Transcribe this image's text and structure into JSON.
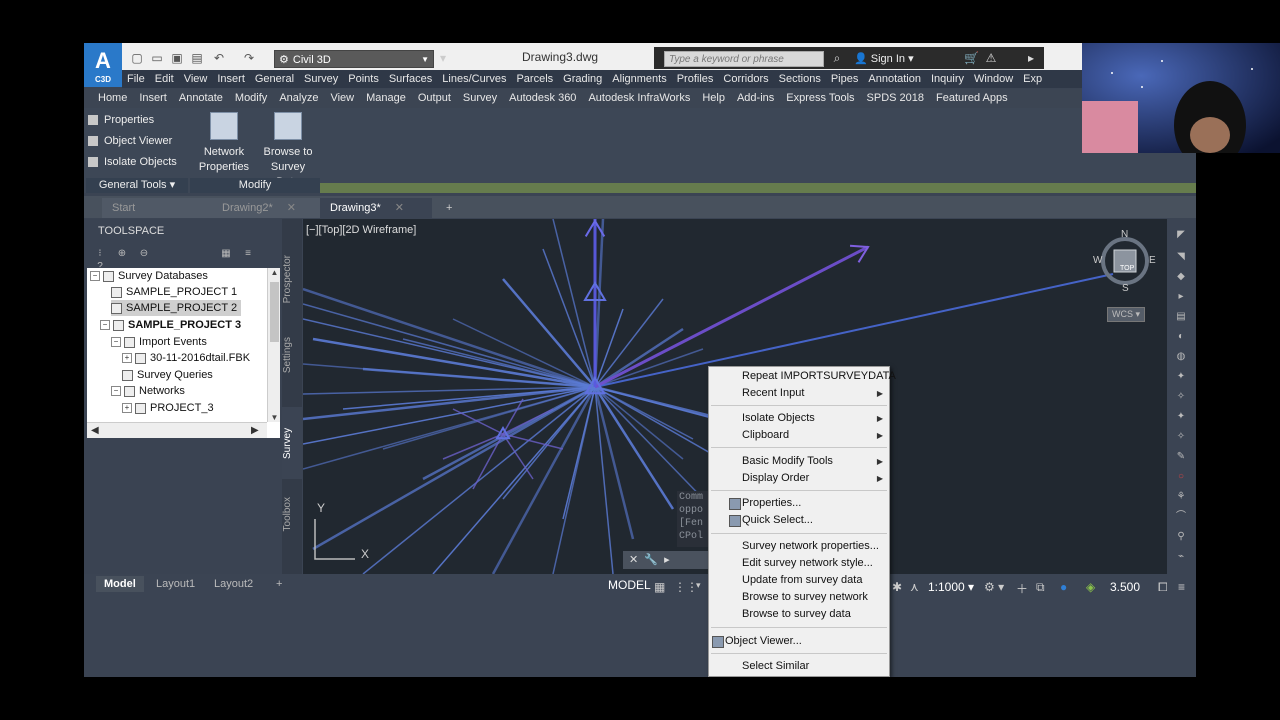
{
  "window": {
    "logo": "A",
    "logo_sub": "C3D",
    "workspace": "Civil 3D",
    "document_title": "Drawing3.dwg",
    "search_placeholder": "Type a keyword or phrase",
    "sign_in": "Sign In"
  },
  "menubar": [
    "File",
    "Edit",
    "View",
    "Insert",
    "General",
    "Survey",
    "Points",
    "Surfaces",
    "Lines/Curves",
    "Parcels",
    "Grading",
    "Alignments",
    "Profiles",
    "Corridors",
    "Sections",
    "Pipes",
    "Annotation",
    "Inquiry",
    "Window",
    "Exp"
  ],
  "ribbon_tabs": [
    "Home",
    "Insert",
    "Annotate",
    "Modify",
    "Analyze",
    "View",
    "Manage",
    "Output",
    "Survey",
    "Autodesk 360",
    "Autodesk InfraWorks",
    "Help",
    "Add-ins",
    "Express Tools",
    "SPDS 2018",
    "Featured Apps"
  ],
  "ribbon": {
    "general_tools": [
      "Properties",
      "Object Viewer",
      "Isolate Objects"
    ],
    "general_tools_caption": "General Tools",
    "network_properties": [
      "Network",
      "Properties"
    ],
    "browse_survey": [
      "Browse to",
      "Survey Data"
    ],
    "modify_caption": "Modify"
  },
  "doc_tabs": [
    {
      "label": "Start"
    },
    {
      "label": "Drawing2*"
    },
    {
      "label": "Drawing3*"
    }
  ],
  "toolspace": {
    "title": "TOOLSPACE",
    "tree": [
      {
        "label": "Survey Databases"
      },
      {
        "label": "SAMPLE_PROJECT 1"
      },
      {
        "label": "SAMPLE_PROJECT 2"
      },
      {
        "label": "SAMPLE_PROJECT 3"
      },
      {
        "label": "Import Events"
      },
      {
        "label": "30-11-2016dtail.FBK"
      },
      {
        "label": "Survey Queries"
      },
      {
        "label": "Networks"
      },
      {
        "label": "PROJECT_3"
      }
    ],
    "side_tabs": [
      "Prospector",
      "Settings",
      "Survey",
      "Toolbox"
    ]
  },
  "viewport": {
    "caption": "[−][Top][2D Wireframe]",
    "compass": {
      "n": "N",
      "s": "S",
      "e": "E",
      "w": "W",
      "top": "TOP",
      "wcs": "WCS"
    },
    "ucs_x": "X",
    "ucs_y": "Y",
    "command_history": [
      "Comm",
      "oppo",
      "[Fen",
      "CPol"
    ]
  },
  "layout_tabs": [
    "Model",
    "Layout1",
    "Layout2"
  ],
  "status": {
    "model": "MODEL",
    "scale": "1:1000",
    "value": "3.500"
  },
  "context_menu": {
    "items": [
      {
        "label": "Repeat IMPORTSURVEYDATA"
      },
      {
        "label": "Recent Input"
      },
      {
        "label": "Isolate Objects"
      },
      {
        "label": "Clipboard"
      },
      {
        "label": "Basic Modify Tools"
      },
      {
        "label": "Display Order"
      },
      {
        "label": "Properties..."
      },
      {
        "label": "Quick Select..."
      },
      {
        "label": "Survey network properties..."
      },
      {
        "label": "Edit survey network style..."
      },
      {
        "label": "Update from survey data"
      },
      {
        "label": "Browse to survey network"
      },
      {
        "label": "Browse to survey data"
      },
      {
        "label": "Object Viewer..."
      },
      {
        "label": "Select Similar"
      }
    ]
  },
  "colors": {
    "app_bg": "#3b4453",
    "viewport_bg": "#212830",
    "network_lines": "#5b7bd5",
    "accent_green": "#667c4d"
  }
}
